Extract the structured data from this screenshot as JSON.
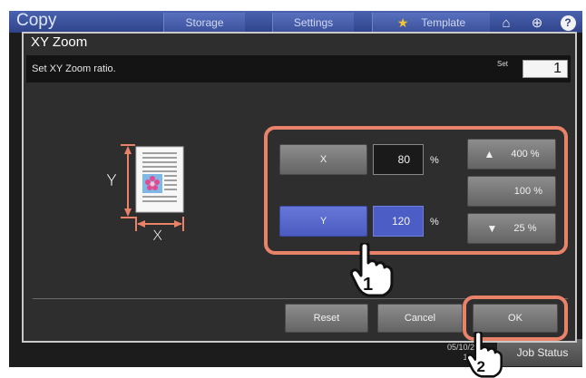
{
  "background": {
    "app_title": "Copy",
    "tabs": [
      "Storage",
      "Settings",
      "Template"
    ],
    "job_status": "Job Status",
    "clock_date": "05/10/20",
    "clock_time": "15:3"
  },
  "dialog": {
    "title": "XY Zoom",
    "message": "Set XY Zoom ratio.",
    "set_label": "Set",
    "set_value": "1",
    "x_button": "X",
    "x_value": "80",
    "y_button": "Y",
    "y_value": "120",
    "percent": "%",
    "preset_400": "400 %",
    "preset_100": "100 %",
    "preset_25": "25 %",
    "reset": "Reset",
    "cancel": "Cancel",
    "ok": "OK"
  },
  "illustration": {
    "y_label": "Y",
    "x_label": "X"
  },
  "callouts": {
    "step1": "1",
    "step2": "2"
  },
  "colors": {
    "accent": "#4b5bc0",
    "highlight": "#e8836a"
  }
}
